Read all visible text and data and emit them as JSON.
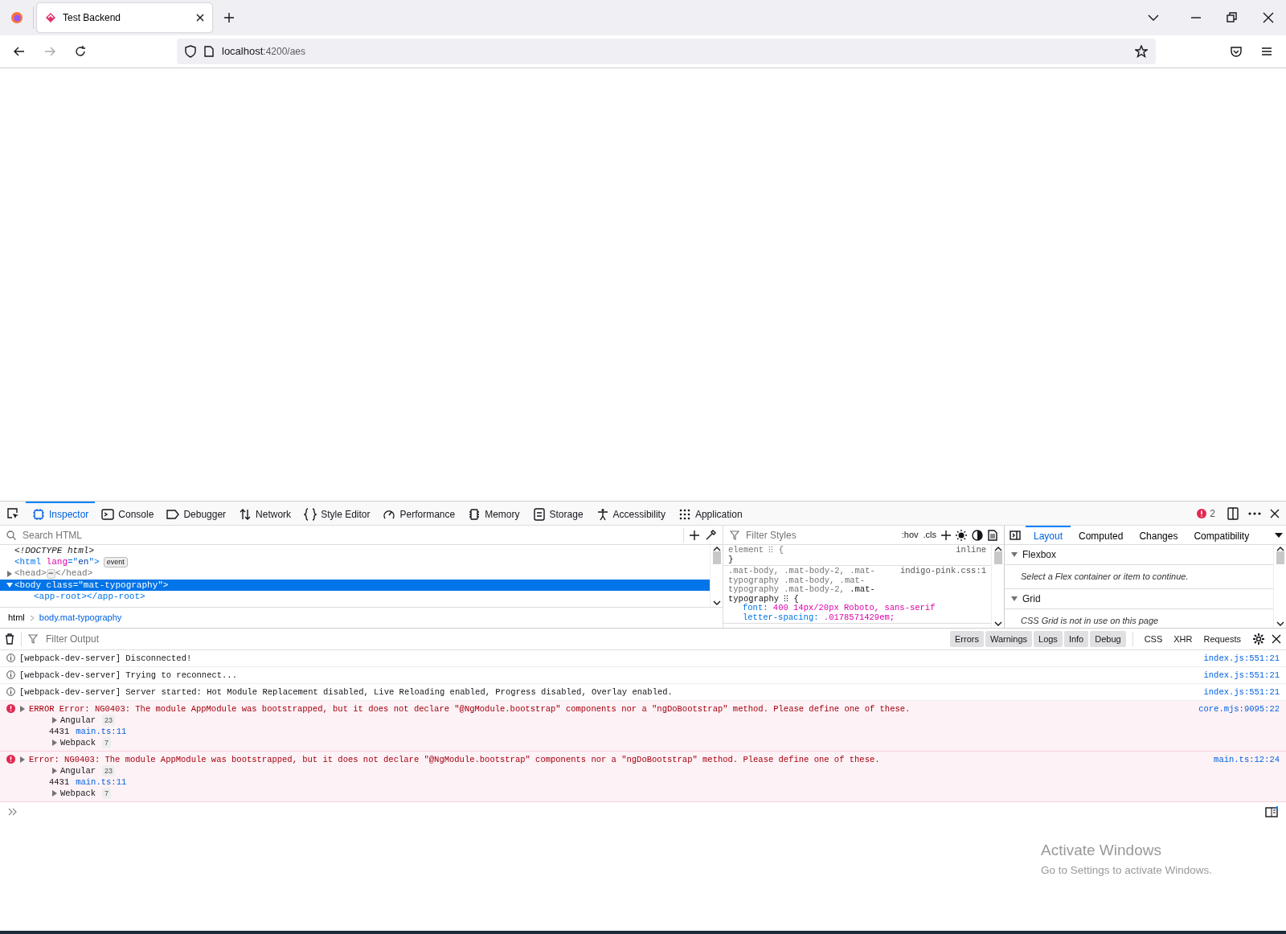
{
  "browser": {
    "tabs": [
      {
        "title": "Test Backend",
        "selected": true
      }
    ],
    "url": {
      "host": "localhost",
      "path": ":4200/aes"
    }
  },
  "devtools": {
    "tabs": [
      {
        "label": "Inspector",
        "selected": true
      },
      {
        "label": "Console",
        "selected": false
      },
      {
        "label": "Debugger",
        "selected": false
      },
      {
        "label": "Network",
        "selected": false
      },
      {
        "label": "Style Editor",
        "selected": false
      },
      {
        "label": "Performance",
        "selected": false
      },
      {
        "label": "Memory",
        "selected": false
      },
      {
        "label": "Storage",
        "selected": false
      },
      {
        "label": "Accessibility",
        "selected": false
      },
      {
        "label": "Application",
        "selected": false
      }
    ],
    "error_count": "2"
  },
  "inspector": {
    "search_placeholder": "Search HTML",
    "markup": [
      {
        "selected": false,
        "tokens": [
          {
            "kind": "doctype",
            "text": "<!DOCTYPE html>"
          }
        ]
      },
      {
        "selected": false,
        "tokens": [
          {
            "kind": "tag",
            "text": "<html "
          },
          {
            "kind": "attr",
            "text": "lang"
          },
          {
            "kind": "tag",
            "text": "=\""
          },
          {
            "kind": "value",
            "text": "en"
          },
          {
            "kind": "tag",
            "text": "\">"
          }
        ],
        "badge": "event"
      },
      {
        "selected": false,
        "expanded": false,
        "tokens": [
          {
            "kind": "dim",
            "text": "<head>"
          },
          {
            "kind": "ellipsis",
            "text": "⋯"
          },
          {
            "kind": "dim",
            "text": "</head>"
          }
        ]
      },
      {
        "selected": true,
        "expanded": true,
        "tokens": [
          {
            "kind": "tag",
            "text": "<body "
          },
          {
            "kind": "attr",
            "text": "class"
          },
          {
            "kind": "tag",
            "text": "=\""
          },
          {
            "kind": "value",
            "text": "mat-typography"
          },
          {
            "kind": "tag",
            "text": "\">"
          }
        ],
        "children": [
          {
            "selected": false,
            "tokens": [
              {
                "kind": "tag",
                "text": "<app-root></app-root>"
              }
            ]
          }
        ]
      }
    ],
    "breadcrumbs": [
      {
        "label": "html",
        "selected": false
      },
      {
        "label": "body.mat-typography",
        "selected": true
      }
    ],
    "rules": {
      "filter_placeholder": "Filter Styles",
      "toggles": [
        ":hov",
        ".cls"
      ],
      "items": [
        {
          "selector": "element ⁝⁝ {",
          "source": "inline",
          "close": "}"
        },
        {
          "selector": ".mat-body, .mat-body-2, .mat-typography .mat-body, .mat-typography .mat-body-2, ",
          "matched": ".mat-typography ⁝⁝ {",
          "source": "indigo-pink.css:1",
          "declarations": [
            {
              "property": "font:",
              "value": "400 14px/20px Roboto, sans-serif"
            },
            {
              "property": "letter-spacing:",
              "value": ".0178571429em;"
            }
          ]
        }
      ]
    },
    "sidebar": {
      "tabs": [
        {
          "label": "Layout",
          "selected": true
        },
        {
          "label": "Computed",
          "selected": false
        },
        {
          "label": "Changes",
          "selected": false
        },
        {
          "label": "Compatibility",
          "selected": false
        }
      ],
      "sections": [
        {
          "title": "Flexbox",
          "expanded": true,
          "note": "Select a Flex container or item to continue."
        },
        {
          "title": "Grid",
          "expanded": true,
          "note": "CSS Grid is not in use on this page"
        }
      ]
    }
  },
  "console": {
    "filter_placeholder": "Filter Output",
    "levels": [
      {
        "label": "Errors",
        "on": true
      },
      {
        "label": "Warnings",
        "on": true
      },
      {
        "label": "Logs",
        "on": true
      },
      {
        "label": "Info",
        "on": true
      },
      {
        "label": "Debug",
        "on": true
      }
    ],
    "net_filters": [
      {
        "label": "CSS",
        "on": false
      },
      {
        "label": "XHR",
        "on": false
      },
      {
        "label": "Requests",
        "on": false
      }
    ],
    "messages": [
      {
        "kind": "info",
        "text": "[webpack-dev-server] Disconnected!",
        "source": "index.js:551:21"
      },
      {
        "kind": "info",
        "text": "[webpack-dev-server] Trying to reconnect...",
        "source": "index.js:551:21"
      },
      {
        "kind": "info",
        "text": "[webpack-dev-server] Server started: Hot Module Replacement disabled, Live Reloading enabled, Progress disabled, Overlay enabled.",
        "source": "index.js:551:21"
      },
      {
        "kind": "error",
        "text": "ERROR Error: NG0403: The module AppModule was bootstrapped, but it does not declare \"@NgModule.bootstrap\" components nor a \"ngDoBootstrap\" method. Please define one of these.",
        "source": "core.mjs:9095:22",
        "stack": [
          {
            "kind": "group",
            "label": "Angular",
            "count": "23"
          },
          {
            "kind": "frame",
            "label": "4431",
            "link": "main.ts:11"
          },
          {
            "kind": "group",
            "label": "Webpack",
            "count": "7"
          }
        ]
      },
      {
        "kind": "error",
        "text": "Error: NG0403: The module AppModule was bootstrapped, but it does not declare \"@NgModule.bootstrap\" components nor a \"ngDoBootstrap\" method. Please define one of these.",
        "source": "main.ts:12:24",
        "stack": [
          {
            "kind": "group",
            "label": "Angular",
            "count": "23"
          },
          {
            "kind": "frame",
            "label": "4431",
            "link": "main.ts:11"
          },
          {
            "kind": "group",
            "label": "Webpack",
            "count": "7"
          }
        ]
      }
    ]
  },
  "windows_notice": {
    "title": "Activate Windows",
    "text": "Go to Settings to activate Windows."
  }
}
